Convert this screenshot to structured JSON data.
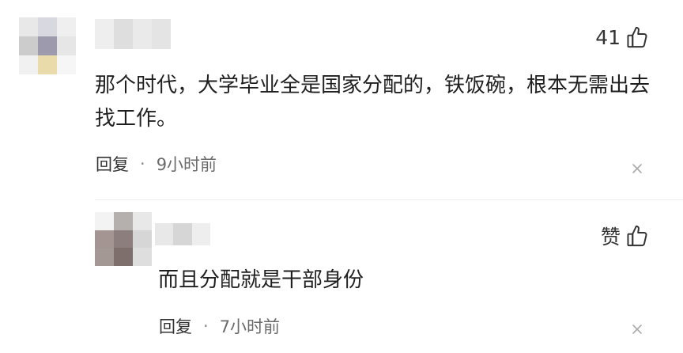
{
  "colors": {
    "background": "#ffffff",
    "text": "#1f1f1f",
    "meta_text": "#6b6b6b",
    "icon_stroke": "#333333"
  },
  "comment": {
    "like_count": "41",
    "text": "那个时代，大学毕业全是国家分配的，铁饭碗，根本无需出去找工作。",
    "reply_label": "回复",
    "separator": "·",
    "time": "9小时前",
    "avatar_colors": [
      "#e8e8e8",
      "#d8d8e0",
      "#efefef",
      "#cccccc",
      "#9e9aae",
      "#e6e6e6",
      "#f1f1f1",
      "#e9dcaa",
      "#f6f6f6"
    ],
    "name_colors": [
      "#eeeeee",
      "#dedede",
      "#eaeaea",
      "#e4e4e4"
    ]
  },
  "reply": {
    "like_label": "赞",
    "text": "而且分配就是干部身份",
    "reply_label": "回复",
    "separator": "·",
    "time": "7小时前",
    "avatar_colors": [
      "#f3f3f3",
      "#b5b0ae",
      "#e8e8e8",
      "#a49593",
      "#8b7e7c",
      "#d6d6d6",
      "#a39894",
      "#7e6f6d",
      "#dedede"
    ],
    "name_colors": [
      "#e8e8e8",
      "#d6d6d6",
      "#eeeeee"
    ]
  },
  "icons": {
    "like": "thumbs-up-icon",
    "close": "close-icon"
  }
}
